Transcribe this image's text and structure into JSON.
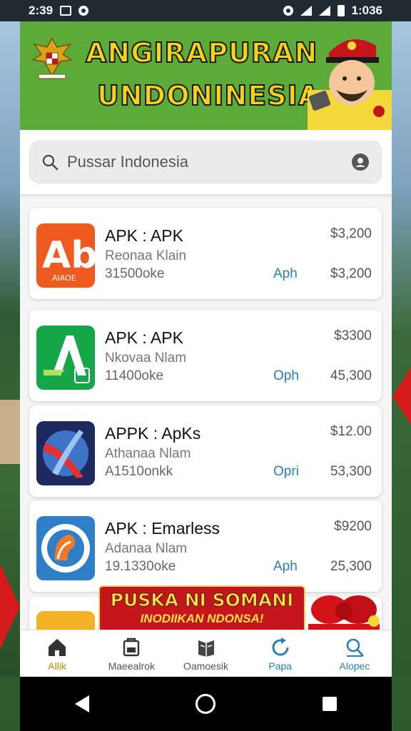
{
  "status_bar": {
    "time": "2:39",
    "battery": "1:036"
  },
  "banner": {
    "line1": "ANGIRAPURAN",
    "line2": "UNDONINESIA"
  },
  "search": {
    "placeholder": "Pussar Indonesia"
  },
  "apps": [
    {
      "name": "APK : APK",
      "developer": "Reonaa Klain",
      "downloads": "31500oke",
      "action": "Aph",
      "price": "$3,200",
      "price2": "$3,200",
      "icon": "ab-logo-icon",
      "icon_color": "#ef5a1e"
    },
    {
      "name": "APK : APK",
      "developer": "Nkovaa Nlam",
      "downloads": "11400oke",
      "action": "Oph",
      "price": "$3300",
      "price2": "45,300",
      "icon": "a-logo-icon",
      "icon_color": "#16a64a"
    },
    {
      "name": "APPK : ApKs",
      "developer": "Athanaa Nlam",
      "downloads": "A1510onkk",
      "action": "Opri",
      "price": "$12.00",
      "price2": "53,300",
      "icon": "x-logo-icon",
      "icon_color": "#1c2a5e"
    },
    {
      "name": "APK : Emarless",
      "developer": "Adanaa Nlam",
      "downloads": "19.1330oke",
      "action": "Aph",
      "price": "$9200",
      "price2": "25,300",
      "icon": "eagle-logo-icon",
      "icon_color": "#2f7fc8"
    }
  ],
  "promo": {
    "line1": "PUSKA NI SOMANI",
    "line2": "INODIIKAN NDONSA!"
  },
  "bottom_nav": [
    {
      "label": "Allik",
      "icon": "home-icon"
    },
    {
      "label": "Maeealrok",
      "icon": "bag-icon"
    },
    {
      "label": "Oamoesik",
      "icon": "book-icon"
    },
    {
      "label": "Papa",
      "icon": "refresh-icon"
    },
    {
      "label": "Alopec",
      "icon": "search-icon"
    }
  ]
}
